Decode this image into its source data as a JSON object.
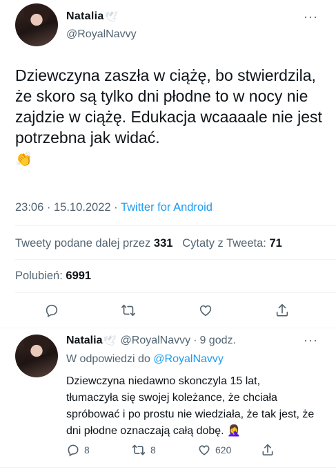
{
  "main_tweet": {
    "display_name": "Natalia",
    "name_emoji": "🕊",
    "handle": "@RoyalNavvy",
    "more": "···",
    "text": "Dziewczyna zaszła w ciążę, bo stwierdzila, że skoro są tylko dni płodne to w nocy nie zajdzie w ciążę. Edukacja wcaaaale nie jest potrzebna jak widać.",
    "text_emoji": "👏",
    "time": "23:06",
    "sep1": "·",
    "date": "15.10.2022",
    "sep2": "·",
    "source": "Twitter for Android",
    "retweets_label": "Tweety podane dalej przez",
    "retweets_count": "331",
    "quotes_label": "Cytaty z Tweeta:",
    "quotes_count": "71",
    "likes_label": "Polubień:",
    "likes_count": "6991"
  },
  "icons": {
    "reply": "reply-icon",
    "retweet": "retweet-icon",
    "like": "like-icon",
    "share": "share-icon"
  },
  "reply_tweet": {
    "display_name": "Natalia",
    "name_emoji": "🕊",
    "handle": "@RoyalNavvy",
    "sep": "·",
    "time_ago": "9 godz.",
    "more": "···",
    "reply_prefix": "W odpowiedzi do",
    "reply_to": "@RoyalNavvy",
    "text": "Dziewczyna niedawno skonczyla 15 lat, tłumaczyła się swojej koleżance, że chciała spróbować i po prostu nie wiedziała, że tak jest, że dni płodne oznaczają całą dobę.",
    "text_emoji": "🤦‍♀️",
    "reply_count": "8",
    "retweet_count": "8",
    "like_count": "620"
  },
  "colors": {
    "link": "#1d9bf0",
    "secondary": "#536471",
    "text": "#0f1419",
    "divider": "#eff3f4"
  }
}
